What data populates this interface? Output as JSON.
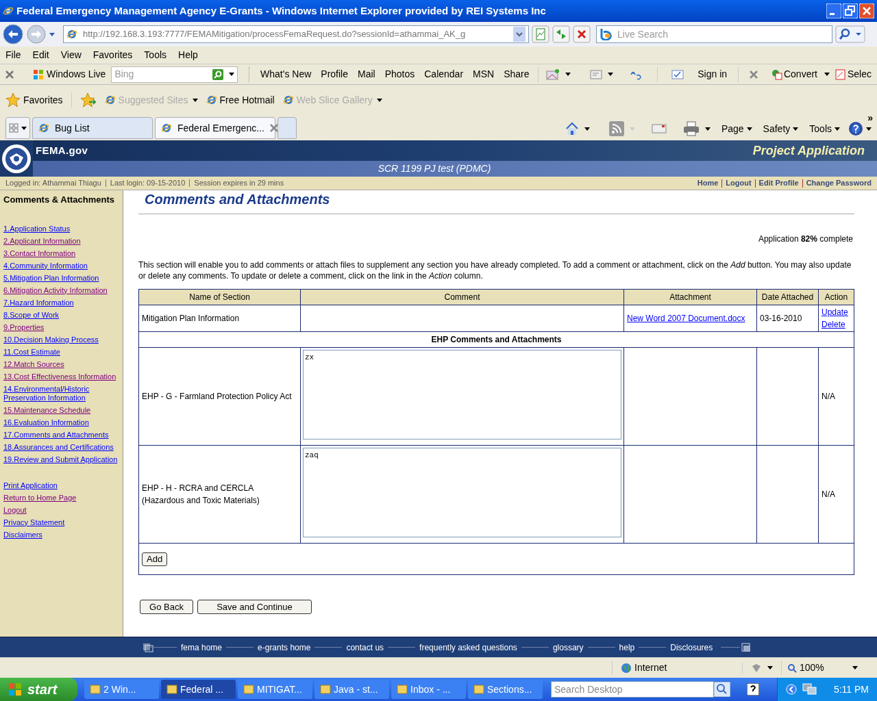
{
  "browser": {
    "title": "Federal Emergency Management Agency E-Grants - Windows Internet Explorer provided by REI Systems Inc",
    "address": "http://192.168.3.193:7777/FEMAMitigation/processFemaRequest.do?sessionId=athammai_AK_g",
    "search_placeholder": "Live Search",
    "menu": [
      "File",
      "Edit",
      "View",
      "Favorites",
      "Tools",
      "Help"
    ],
    "live_toolbar": {
      "brand": "Windows Live",
      "search_placeholder": "Bing",
      "links": [
        "What's New",
        "Profile",
        "Mail",
        "Photos",
        "Calendar",
        "MSN",
        "Share"
      ],
      "sign_in": "Sign in",
      "convert": "Convert",
      "select": "Selec"
    },
    "favorites_bar": {
      "label": "Favorites",
      "items": [
        {
          "label": "Suggested Sites",
          "dimmed": true,
          "menu": true
        },
        {
          "label": "Free Hotmail",
          "dimmed": false,
          "menu": false
        },
        {
          "label": "Web Slice Gallery",
          "dimmed": true,
          "menu": true
        }
      ]
    },
    "tabs": [
      {
        "label": "Bug List",
        "selected": false
      },
      {
        "label": "Federal Emergenc...",
        "selected": true
      }
    ],
    "command_bar": [
      "Page",
      "Safety",
      "Tools"
    ],
    "more": "»"
  },
  "site": {
    "brand": "FEMA.gov",
    "banner_title": "Project Application",
    "project": "SCR 1199 PJ test (PDMC)",
    "login_info": [
      "Logged in: Athammai Thiagu",
      "Last login: 09-15-2010",
      "Session expires in 29 mins"
    ],
    "top_links": [
      "Home",
      "Logout",
      "Edit Profile",
      "Change Password"
    ]
  },
  "sidebar": {
    "title": "Comments & Attachments",
    "sections": [
      {
        "label": "1.Application Status",
        "visited": false
      },
      {
        "label": "2.Applicant Information",
        "visited": true
      },
      {
        "label": "3.Contact Information",
        "visited": true
      },
      {
        "label": "4.Community Information",
        "visited": false
      },
      {
        "label": "5.Mitigation Plan Information",
        "visited": false
      },
      {
        "label": "6.Mitigation Activity Information",
        "visited": true
      },
      {
        "label": "7.Hazard Information",
        "visited": false
      },
      {
        "label": "8.Scope of Work",
        "visited": false
      },
      {
        "label": "9.Properties",
        "visited": true
      },
      {
        "label": "10.Decision Making Process",
        "visited": false
      },
      {
        "label": "11.Cost Estimate",
        "visited": false
      },
      {
        "label": "12.Match Sources",
        "visited": true
      },
      {
        "label": "13.Cost Effectiveness Information",
        "visited": true
      },
      {
        "label": "14.Environmental/Historic Preservation Information",
        "visited": false
      },
      {
        "label": "15.Maintenance Schedule",
        "visited": true
      },
      {
        "label": "16.Evaluation Information",
        "visited": false
      },
      {
        "label": "17.Comments and Attachments",
        "visited": false
      },
      {
        "label": "18.Assurances and Certifications",
        "visited": false
      },
      {
        "label": "19.Review and Submit Application",
        "visited": false
      }
    ],
    "utility_links": [
      {
        "label": "Print Application",
        "visited": false
      },
      {
        "label": "Return to Home Page",
        "visited": true
      },
      {
        "label": "Logout",
        "visited": true
      },
      {
        "label": "Privacy Statement",
        "visited": false
      },
      {
        "label": "Disclaimers",
        "visited": false
      }
    ]
  },
  "main": {
    "heading": "Comments and Attachments",
    "progress": "Application **82%** complete",
    "intro": "This section will enable you to add comments or attach files to supplement any section you have already completed. To add a comment or attachment, click on the *Add* button. You may also update or delete any comments. To update or delete a comment, click on the link in the *Action* column.",
    "table": {
      "columns": [
        "Name of Section",
        "Comment",
        "Attachment",
        "Date Attached",
        "Action"
      ],
      "rows": [
        {
          "section": "Mitigation Plan Information",
          "attachment": "New Word 2007 Document.docx",
          "date": "03-16-2010",
          "actions": [
            "Update",
            "Delete"
          ]
        }
      ],
      "ehp_heading": "EHP Comments and Attachments",
      "ehp_rows": [
        {
          "section": "EHP - G - Farmland Protection Policy Act",
          "comment": "zx",
          "action": "N/A"
        },
        {
          "section": "EHP - H - RCRA and CERCLA (Hazardous and Toxic Materials)",
          "comment": "zaq",
          "action": "N/A"
        }
      ],
      "add_button": "Add"
    },
    "buttons": [
      "Go Back",
      "Save and Continue"
    ]
  },
  "footer_links": [
    "fema home",
    "e-grants home",
    "contact us",
    "frequently asked questions",
    "glossary",
    "help",
    "Disclosures"
  ],
  "status_bar": {
    "zone": "Internet",
    "zoom": "100%"
  },
  "taskbar": {
    "start": "start",
    "items": [
      {
        "label": "2 Win...",
        "selected": false
      },
      {
        "label": "Federal ...",
        "selected": true
      },
      {
        "label": "MITIGAT...",
        "selected": false
      },
      {
        "label": "Java - st...",
        "selected": false
      },
      {
        "label": "Inbox - ...",
        "selected": false
      },
      {
        "label": "Sections...",
        "selected": false
      }
    ],
    "search_placeholder": "Search Desktop",
    "clock": "5:11 PM"
  }
}
